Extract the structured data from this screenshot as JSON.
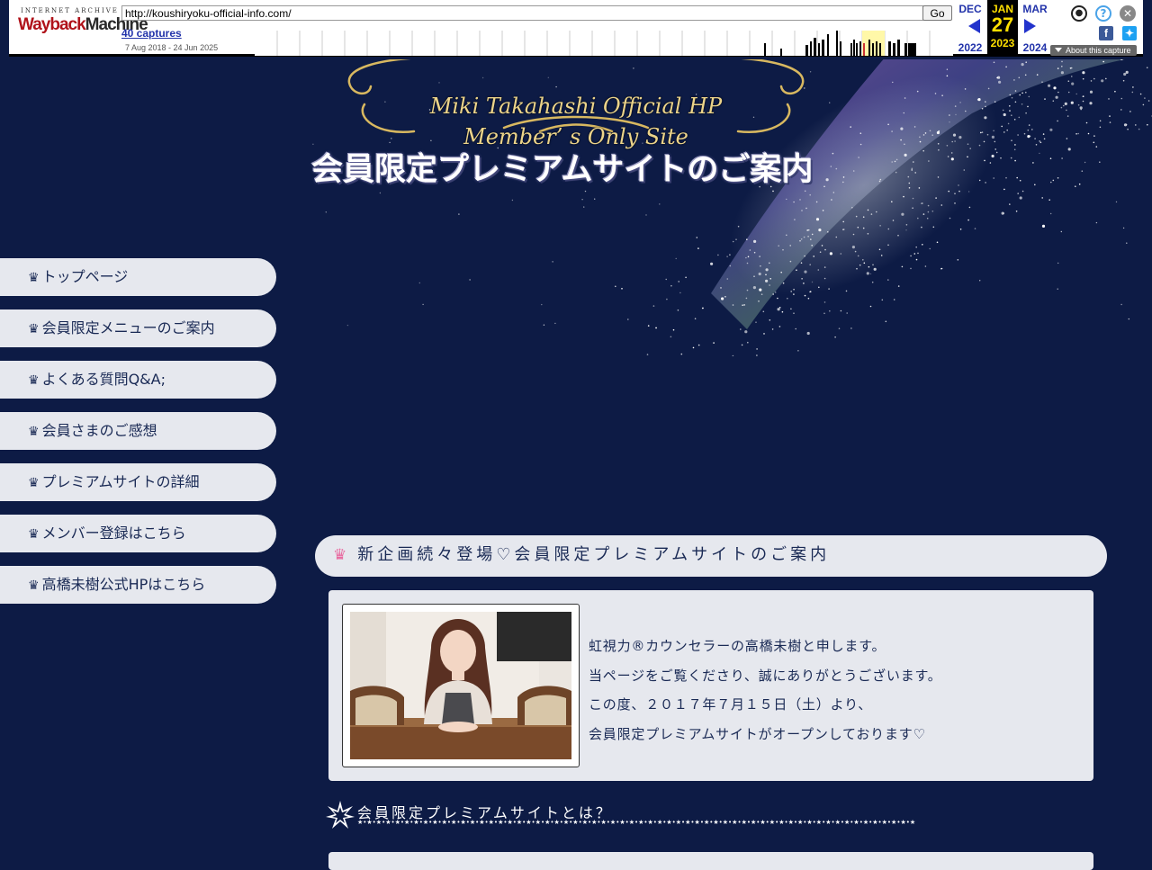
{
  "wayback": {
    "logo_top": "INTERNET ARCHIVE",
    "logo_main_1": "Wayback",
    "logo_main_2": "Machine",
    "url": "http://koushiryoku-official-info.com/",
    "go_label": "Go",
    "captures": "40 captures",
    "date_range": "7 Aug 2018 - 24 Jun 2025",
    "prev_month": "DEC",
    "prev_year": "2022",
    "cur_month": "JAN",
    "cur_day": "27",
    "cur_year": "2023",
    "next_month": "MAR",
    "next_year": "2024",
    "about": "About this capture",
    "icons": [
      "user-icon",
      "help-icon",
      "close-icon",
      "facebook-icon",
      "twitter-icon"
    ]
  },
  "banner": {
    "logo_line1": "Miki Takahashi Official HP",
    "logo_line2": "Member’ s Only Site",
    "title": "会員限定プレミアムサイトのご案内"
  },
  "sidebar": {
    "icon": "crown-icon",
    "items": [
      {
        "label": "トップページ"
      },
      {
        "label": "会員限定メニューのご案内"
      },
      {
        "label": "よくある質問Q&A;"
      },
      {
        "label": "会員さまのご感想"
      },
      {
        "label": "プレミアムサイトの詳細"
      },
      {
        "label": "メンバー登録はこちら"
      },
      {
        "label": "高橋未樹公式HPはこちら"
      }
    ]
  },
  "main": {
    "section_title": "新企画続々登場♡会員限定プレミアムサイトのご案内",
    "intro_lines": [
      "虹視力®カウンセラーの高橋未樹と申します。",
      "当ページをご覧くださり、誠にありがとうございます。",
      "この度、２０１７年７月１５日（土）より、",
      "会員限定プレミアムサイトがオープンしております♡"
    ],
    "sub_heading": "会員限定プレミアムサイトとは？"
  },
  "colors": {
    "background": "#0d1b45",
    "panel": "#e6e8ee",
    "text": "#1a2a55",
    "crown_accent": "#e86aa0",
    "gold": "#ecd48a"
  }
}
